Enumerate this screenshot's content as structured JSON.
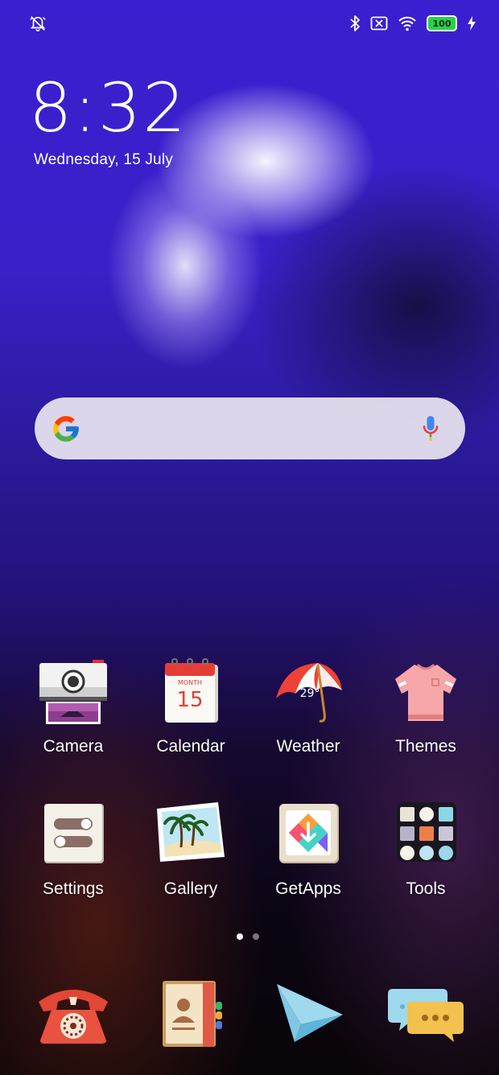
{
  "status_bar": {
    "left_icon": "dnd-vibrate-off-icon",
    "right_icons": [
      "bluetooth-icon",
      "no-sim-icon",
      "wifi-icon",
      "battery-icon",
      "charging-bolt-icon"
    ],
    "battery_level": "100",
    "battery_color": "#27d14a"
  },
  "lock_clock": {
    "time": "8:32",
    "date": "Wednesday, 15 July"
  },
  "search_widget": {
    "left_icon": "google-g-icon",
    "right_icon": "microphone-icon"
  },
  "home_apps": [
    {
      "label": "Camera",
      "icon": "camera-icon"
    },
    {
      "label": "Calendar",
      "icon": "calendar-icon",
      "icon_text_top": "MONTH",
      "icon_text_day": "15"
    },
    {
      "label": "Weather",
      "icon": "weather-umbrella-icon",
      "icon_text": "29°"
    },
    {
      "label": "Themes",
      "icon": "tshirt-icon"
    },
    {
      "label": "Settings",
      "icon": "toggles-icon"
    },
    {
      "label": "Gallery",
      "icon": "palm-beach-icon"
    },
    {
      "label": "GetApps",
      "icon": "getapps-icon"
    },
    {
      "label": "Tools",
      "icon": "tools-folder-icon"
    }
  ],
  "page_indicator": {
    "pages": 2,
    "current": 1
  },
  "dock": [
    {
      "icon": "phone-icon"
    },
    {
      "icon": "contacts-icon"
    },
    {
      "icon": "paper-plane-icon"
    },
    {
      "icon": "messages-icon"
    }
  ],
  "colors": {
    "wallpaper_top": "#3a1fd0",
    "wallpaper_bottom": "#0a0508",
    "search_bar": "#ebe6f2"
  }
}
